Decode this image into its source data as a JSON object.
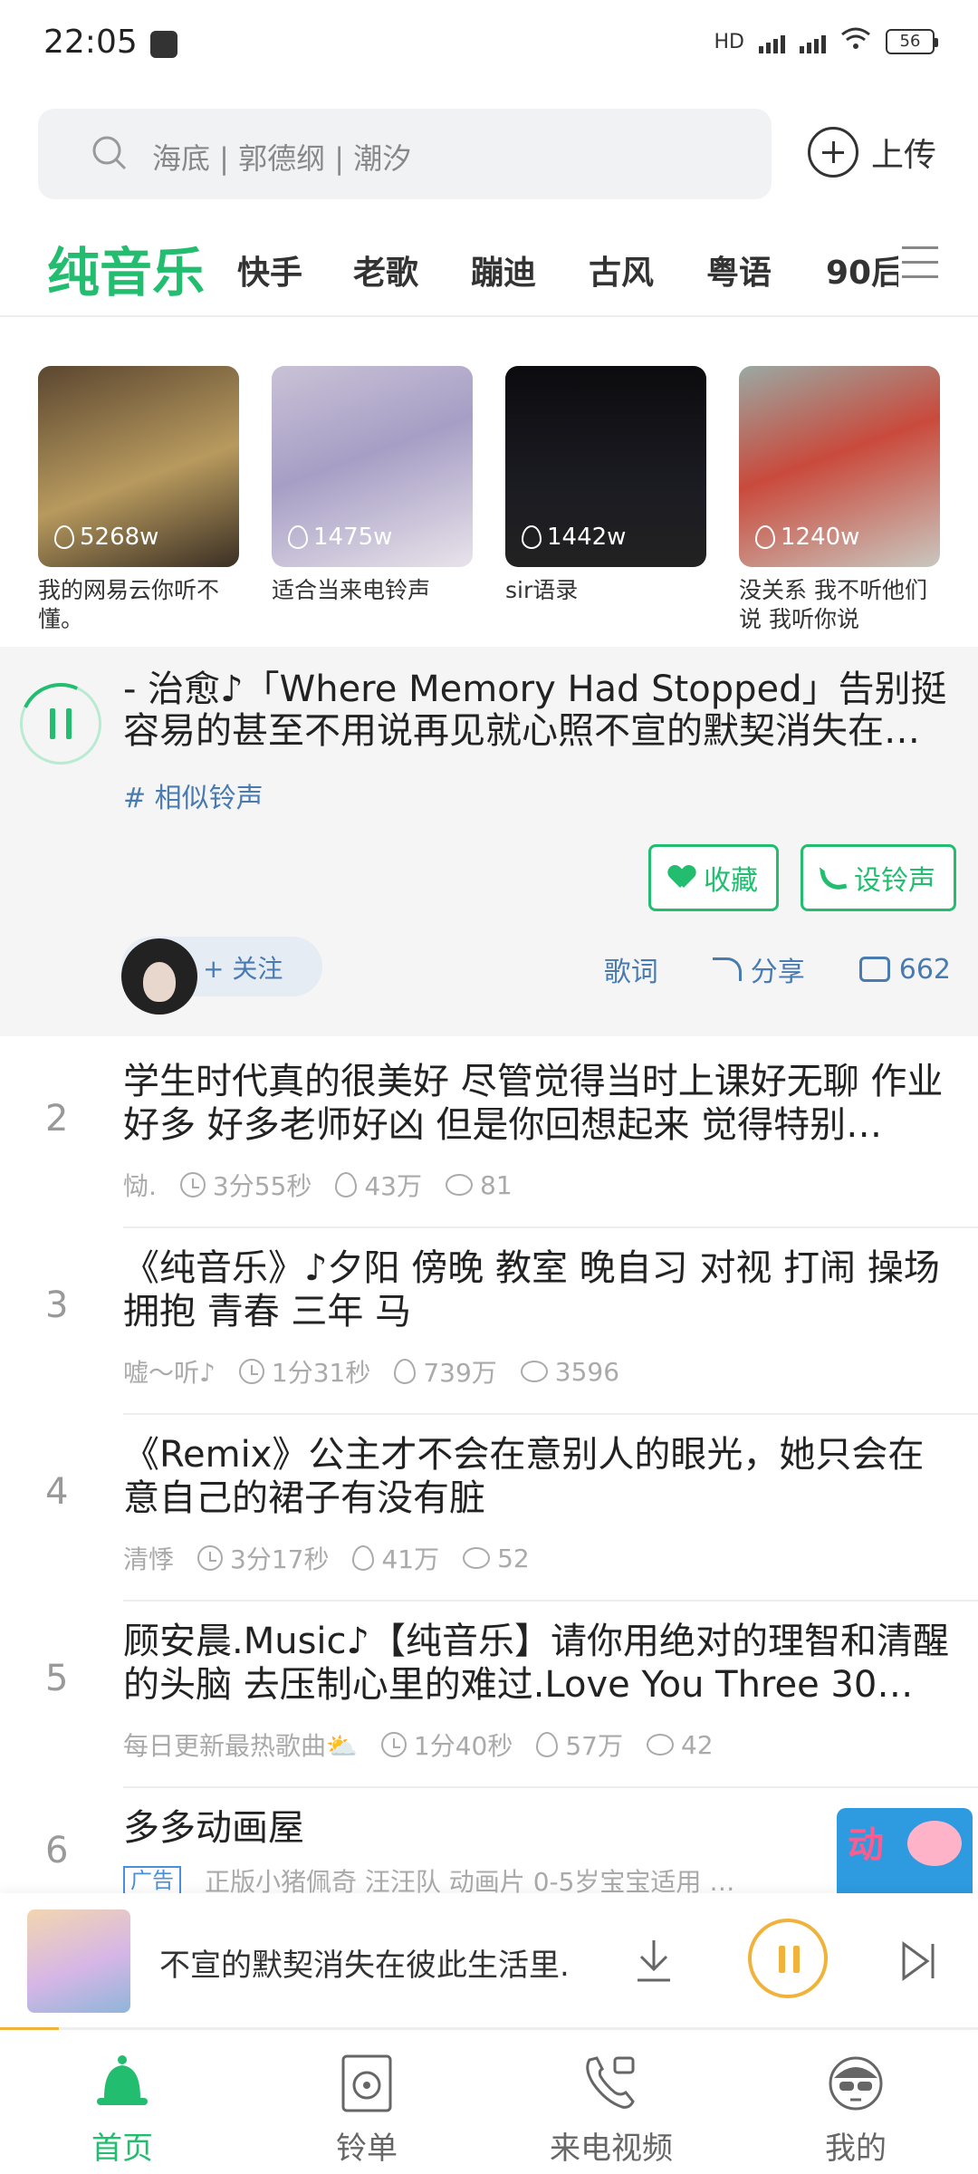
{
  "status_bar": {
    "time": "22:05",
    "network": "4G 5G",
    "hd": "HD",
    "battery": "56"
  },
  "search": {
    "placeholder": "海底 | 郭德纲 | 潮汐",
    "upload_label": "上传"
  },
  "categories": {
    "active": "纯音乐",
    "items": [
      "快手",
      "老歌",
      "蹦迪",
      "古风",
      "粤语",
      "90后"
    ]
  },
  "cards": [
    {
      "count": "5268w",
      "title": "我的网易云你听不懂。"
    },
    {
      "count": "1475w",
      "title": "适合当来电铃声"
    },
    {
      "count": "1442w",
      "title": "sir语录"
    },
    {
      "count": "1240w",
      "title": "没关系 我不听他们说 我听你说"
    }
  ],
  "current": {
    "title": "- 治愈♪「Where Memory Had Stopped」告别挺容易的甚至不用说再见就心照不宣的默契消失在…",
    "tag": "# 相似铃声",
    "collect": "收藏",
    "set_ringtone": "设铃声",
    "follow": "+ 关注",
    "lyrics": "歌词",
    "share": "分享",
    "comments": "662"
  },
  "list": [
    {
      "num": "2",
      "title": "学生时代真的很美好  尽管觉得当时上课好无聊  作业好多 好多老师好凶  但是你回想起来 觉得特别…",
      "author": "恸.",
      "duration": "3分55秒",
      "plays": "43万",
      "comments": "81"
    },
    {
      "num": "3",
      "title": "《纯音乐》♪夕阳  傍晚   教室   晚自习   对视   打闹   操场   拥抱     青春   三年 马",
      "author": "嘘～听♪",
      "duration": "1分31秒",
      "plays": "739万",
      "comments": "3596"
    },
    {
      "num": "4",
      "title": "《Remix》公主才不会在意别人的眼光，她只会在意自己的裙子有没有脏",
      "author": "清悸",
      "duration": "3分17秒",
      "plays": "41万",
      "comments": "52"
    },
    {
      "num": "5",
      "title": "顾安晨.Music♪【纯音乐】请你用绝对的理智和清醒的头脑 去压制心里的难过.Love You Three 30…",
      "author": "每日更新最热歌曲⛅",
      "duration": "1分40秒",
      "plays": "57万",
      "comments": "42"
    },
    {
      "num": "6",
      "title": "多多动画屋",
      "ad_tag": "广告",
      "ad_desc": "正版小猪佩奇  汪汪队 动画片  0-5岁宝宝适用 …",
      "ad_img_text": "动"
    }
  ],
  "player": {
    "lyric": "不宣的默契消失在彼此生活里."
  },
  "progress": 0.06,
  "nav": [
    {
      "label": "首页",
      "icon": "bell-icon",
      "active": true
    },
    {
      "label": "铃单",
      "icon": "speaker-icon",
      "active": false
    },
    {
      "label": "来电视频",
      "icon": "phone-video-icon",
      "active": false
    },
    {
      "label": "我的",
      "icon": "profile-icon",
      "active": false
    }
  ],
  "colors": {
    "accent": "#22bd6f",
    "link": "#4a7bb0",
    "player": "#f0b23b"
  }
}
